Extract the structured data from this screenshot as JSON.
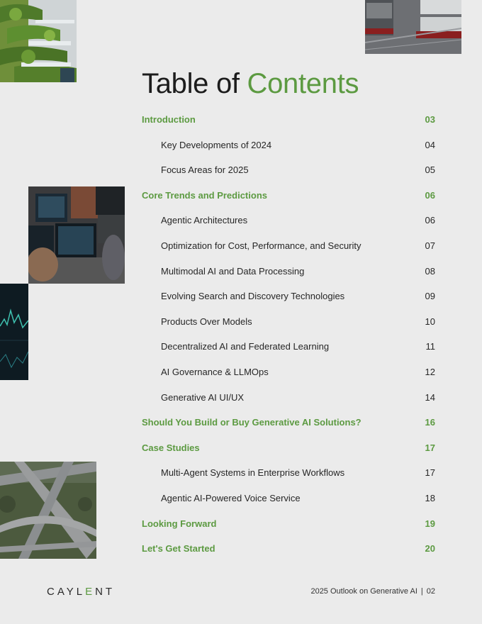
{
  "title": {
    "part1": "Table of ",
    "part2": "Contents"
  },
  "toc": [
    {
      "type": "main",
      "label": "Introduction",
      "page": "03"
    },
    {
      "type": "sub",
      "label": "Key Developments of 2024",
      "page": "04"
    },
    {
      "type": "sub",
      "label": "Focus Areas for 2025",
      "page": "05"
    },
    {
      "type": "main",
      "label": "Core Trends and Predictions",
      "page": "06"
    },
    {
      "type": "sub",
      "label": "Agentic Architectures",
      "page": "06"
    },
    {
      "type": "sub",
      "label": "Optimization for Cost, Performance, and Security",
      "page": "07"
    },
    {
      "type": "sub",
      "label": "Multimodal AI and Data Processing",
      "page": "08"
    },
    {
      "type": "sub",
      "label": "Evolving Search and Discovery Technologies",
      "page": "09"
    },
    {
      "type": "sub",
      "label": "Products Over Models",
      "page": "10"
    },
    {
      "type": "sub",
      "label": "Decentralized AI and Federated Learning",
      "page": "11"
    },
    {
      "type": "sub",
      "label": "AI Governance & LLMOps",
      "page": "12"
    },
    {
      "type": "sub",
      "label": "Generative AI UI/UX",
      "page": "14"
    },
    {
      "type": "main",
      "label": "Should You Build or Buy Generative AI Solutions?",
      "page": "16"
    },
    {
      "type": "main",
      "label": "Case Studies",
      "page": "17"
    },
    {
      "type": "sub",
      "label": "Multi-Agent Systems in Enterprise Workflows",
      "page": "17"
    },
    {
      "type": "sub",
      "label": "Agentic AI-Powered Voice Service",
      "page": "18"
    },
    {
      "type": "main",
      "label": "Looking Forward",
      "page": "19"
    },
    {
      "type": "main",
      "label": "Let's Get Started",
      "page": "20"
    }
  ],
  "footer": {
    "logo_left": "CAYL",
    "logo_e": "E",
    "logo_right": "NT",
    "doc_title": "2025 Outlook on Generative AI",
    "separator": "|",
    "page_number": "02"
  },
  "colors": {
    "accent": "#5c9a41",
    "background": "#ebebeb",
    "text": "#1e1e1e"
  }
}
